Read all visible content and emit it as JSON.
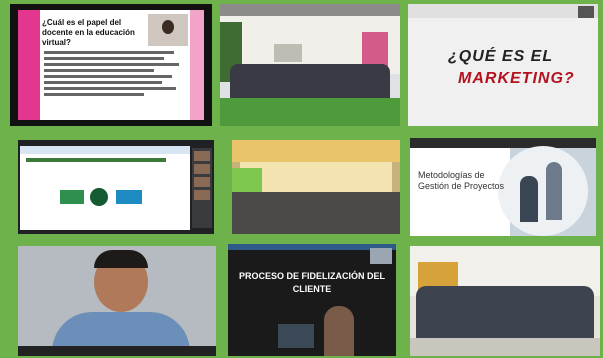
{
  "tiles": [
    {
      "name": "slide-docente",
      "question": "¿Cuál es el papel del docente en la educación virtual?"
    },
    {
      "name": "group-photo-building"
    },
    {
      "name": "marketing-slide",
      "line1": "¿QUÉ ES EL",
      "line2": "MARKETING?",
      "accent": "#b3121e"
    },
    {
      "name": "video-conference-logos"
    },
    {
      "name": "classroom-training"
    },
    {
      "name": "metodologias-slide",
      "text": "Metodologías de Gestión de Proyectos"
    },
    {
      "name": "speaker-video"
    },
    {
      "name": "fidelizacion-slide",
      "text": "PROCESO DE FIDELIZACIÓN DEL CLIENTE"
    },
    {
      "name": "group-photo-indoor"
    }
  ],
  "colors": {
    "background": "#6db24a",
    "pink": "#e2368f"
  }
}
